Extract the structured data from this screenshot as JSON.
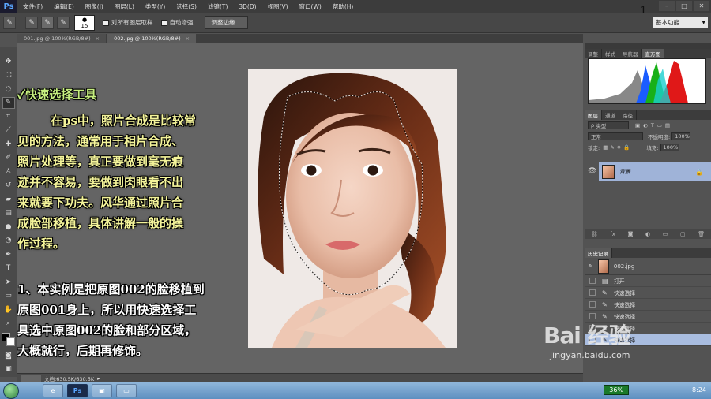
{
  "menubar": {
    "app_logo": "Ps",
    "items": [
      "文件(F)",
      "编辑(E)",
      "图像(I)",
      "图层(L)",
      "类型(Y)",
      "选择(S)",
      "滤镜(T)",
      "3D(D)",
      "视图(V)",
      "窗口(W)",
      "帮助(H)"
    ],
    "page_number": "1"
  },
  "options": {
    "brush_size": "15",
    "sample_all_layers": "对所有图层取样",
    "auto_enhance": "自动增强",
    "refine_edge": "调整边缘...",
    "workspace": "基本功能"
  },
  "tabs": [
    {
      "label": "001.jpg @ 100%(RGB/8#)",
      "active": false
    },
    {
      "label": "002.jpg @ 100%(RGB/8#)",
      "active": true
    }
  ],
  "annotation": {
    "title": "快速选择工具",
    "paragraph1": [
      "在ps中，照片合成是比较常",
      "见的方法，通常用于相片合成、",
      "照片处理等，真正要做到毫无痕",
      "迹并不容易，要做到肉眼看不出",
      "来就要下功夫。风华通过照片合",
      "成脸部移植，具体讲解一般的操",
      "作过程。"
    ],
    "paragraph2_lines": [
      "1、本实例是把原图002的脸移植到",
      "原图001身上，所以用快速选择工",
      "具选中原图002的脸和部分区域，",
      "大概就行，后期再修饰。"
    ]
  },
  "panels": {
    "top_tabs": [
      "调整",
      "样式",
      "导航器",
      "直方图"
    ],
    "layers_tabs": [
      "图层",
      "通道",
      "路径"
    ],
    "kind_filter": "类型",
    "blend_mode": "正常",
    "opacity_label": "不透明度:",
    "opacity_value": "100%",
    "lock_label": "锁定:",
    "fill_label": "填充:",
    "fill_value": "100%",
    "layer_name": "背景",
    "history_tab": "历史记录",
    "history_snapshot": "002.jpg",
    "history_items": [
      {
        "label": "打开",
        "active": false
      },
      {
        "label": "快速选择",
        "active": false
      },
      {
        "label": "快速选择",
        "active": false
      },
      {
        "label": "快速选择",
        "active": false
      },
      {
        "label": "快速选择",
        "active": false
      },
      {
        "label": "快速选择",
        "active": true
      }
    ]
  },
  "statusbar": {
    "doc_info": "文档:630.5K/630.5K"
  },
  "watermark": {
    "logo": "Bai  经验",
    "url": "jingyan.baidu.com"
  },
  "taskbar": {
    "percent": "36%",
    "time": "8:24"
  },
  "colors": {
    "title_green": "#c6ef7f",
    "text_yellow": "#f4f49a",
    "active_layer": "#9fb3d8"
  }
}
